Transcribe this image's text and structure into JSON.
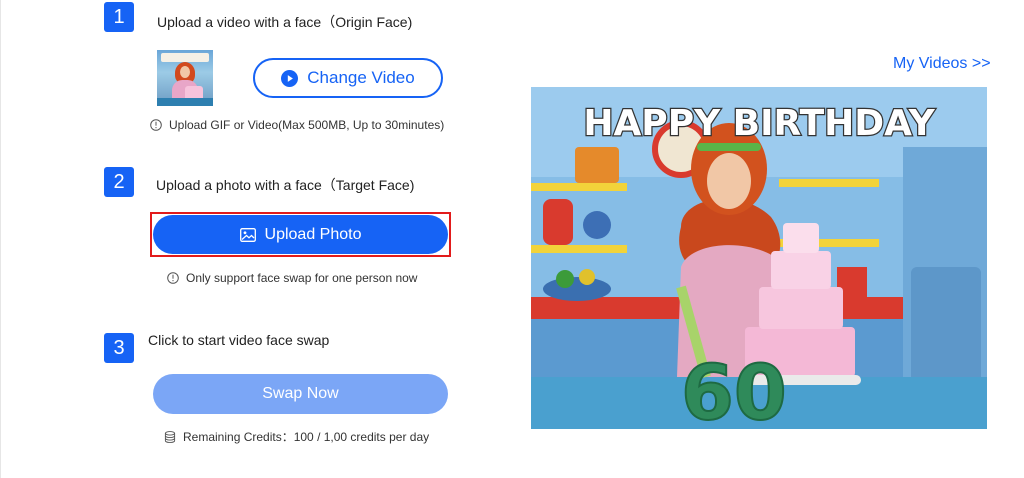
{
  "header": {
    "my_videos_link": "My Videos >>"
  },
  "steps": [
    {
      "number": "1",
      "title": "Upload a video with a face（Origin Face)"
    },
    {
      "number": "2",
      "title": "Upload a photo with a face（Target Face)"
    },
    {
      "number": "3",
      "title": "Click to start video face swap"
    }
  ],
  "step1": {
    "change_video_label": "Change Video",
    "hint": "Upload GIF or Video(Max 500MB, Up to 30minutes)",
    "thumbnail_icon": "video-thumbnail"
  },
  "step2": {
    "upload_photo_label": "Upload Photo",
    "hint": "Only support face swap for one person now"
  },
  "step3": {
    "swap_label": "Swap Now",
    "credits_text": "Remaining Credits：100 / 1,00 credits per day"
  },
  "preview": {
    "banner_text": "HAPPY BIRTHDAY",
    "cake_number": "60"
  },
  "colors": {
    "accent": "#1663f5",
    "accent_disabled": "#7ba6f6",
    "highlight_border": "#e21b1b"
  },
  "icons": {
    "play": "play-circle-icon",
    "info": "info-icon",
    "image": "image-icon",
    "credits": "database-icon"
  }
}
